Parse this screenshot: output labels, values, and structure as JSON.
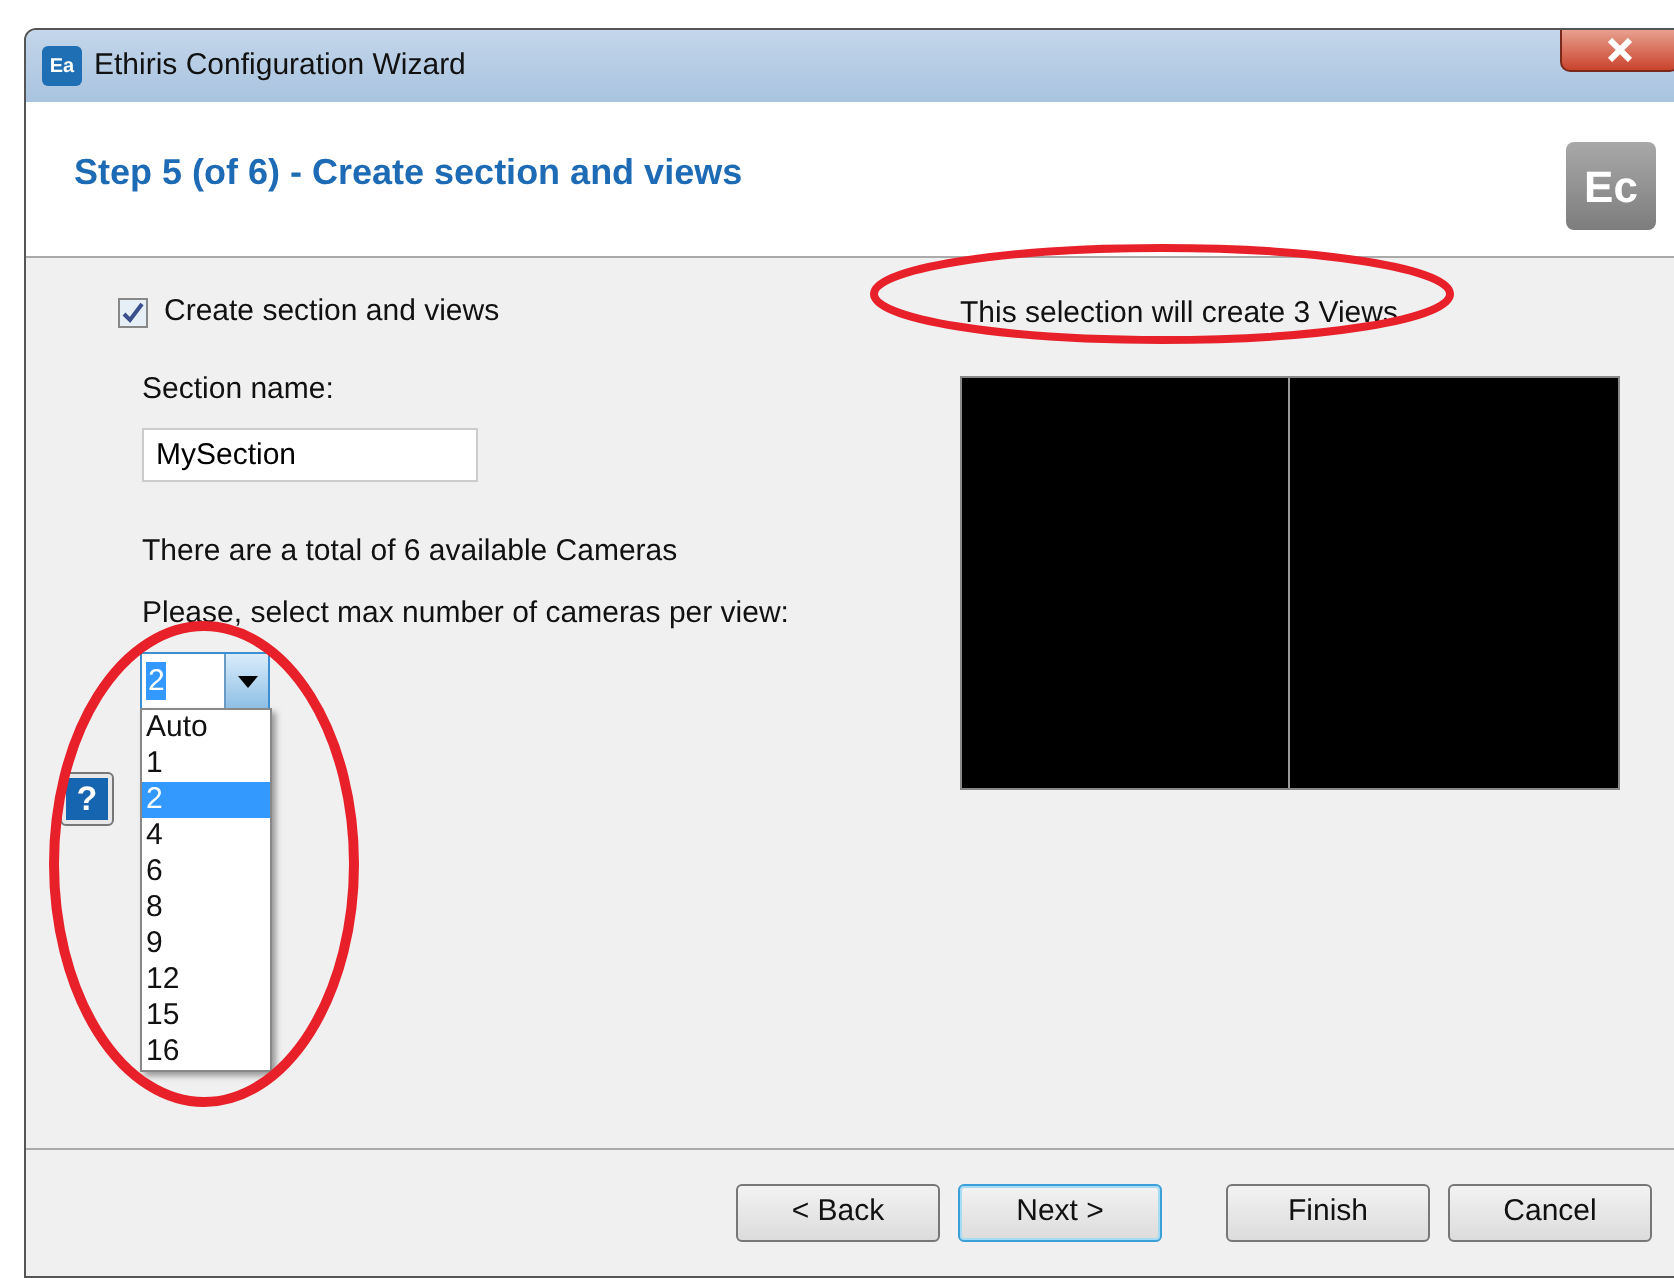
{
  "window": {
    "title": "Ethiris Configuration Wizard",
    "icon_text": "Ea"
  },
  "header": {
    "title": "Step 5 (of 6) - Create section and views",
    "logo_text": "Ec"
  },
  "create_checkbox": {
    "label": "Create section and views",
    "checked": true
  },
  "section_name": {
    "label": "Section name:",
    "value": "MySection"
  },
  "cameras_info": "There are a total of 6 available Cameras",
  "select_prompt": "Please, select max number of cameras per view:",
  "combo": {
    "value": "2",
    "expanded": true,
    "options": [
      {
        "label": "Auto",
        "selected": false
      },
      {
        "label": "1",
        "selected": false
      },
      {
        "label": "2",
        "selected": true
      },
      {
        "label": "4",
        "selected": false
      },
      {
        "label": "6",
        "selected": false
      },
      {
        "label": "8",
        "selected": false
      },
      {
        "label": "9",
        "selected": false
      },
      {
        "label": "12",
        "selected": false
      },
      {
        "label": "15",
        "selected": false
      },
      {
        "label": "16",
        "selected": false
      }
    ]
  },
  "help_button": "?",
  "preview": {
    "caption": "This selection will create 3 Views",
    "panes": [
      {
        "kind": "camera"
      },
      {
        "kind": "camera"
      }
    ]
  },
  "buttons": [
    {
      "label": "< Back",
      "default": false
    },
    {
      "label": "Next >",
      "default": true
    },
    {
      "label": "Finish",
      "default": false
    },
    {
      "label": "Cancel",
      "default": false
    }
  ]
}
